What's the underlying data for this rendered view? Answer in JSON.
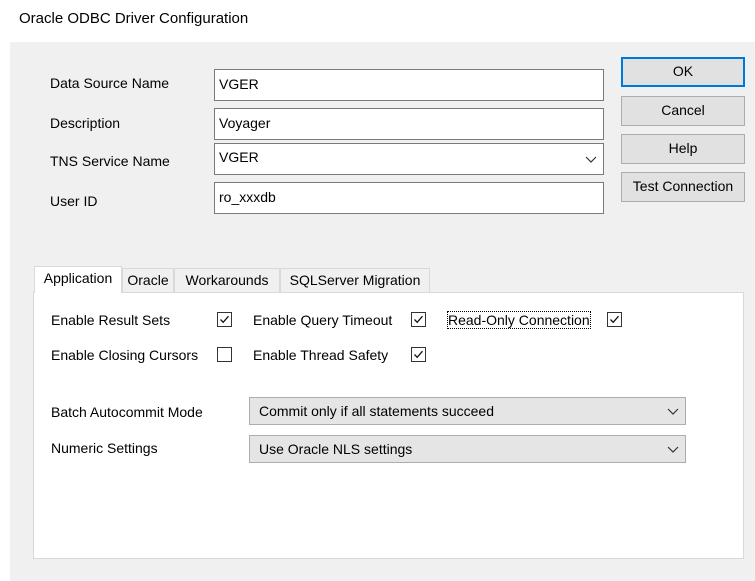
{
  "window": {
    "title": "Oracle ODBC Driver Configuration"
  },
  "form": {
    "data_source_name": {
      "label": "Data Source Name",
      "value": "VGER"
    },
    "description": {
      "label": "Description",
      "value": "Voyager"
    },
    "tns_service_name": {
      "label": "TNS Service Name",
      "value": "VGER"
    },
    "user_id": {
      "label": "User ID",
      "value": "ro_xxxdb"
    }
  },
  "buttons": {
    "ok": "OK",
    "cancel": "Cancel",
    "help": "Help",
    "test_connection": "Test Connection"
  },
  "tabs": [
    "Application",
    "Oracle",
    "Workarounds",
    "SQLServer Migration"
  ],
  "active_tab": "Application",
  "options": {
    "enable_result_sets": {
      "label": "Enable Result Sets",
      "checked": true
    },
    "enable_query_timeout": {
      "label": "Enable Query Timeout",
      "checked": true
    },
    "read_only_connection": {
      "label": "Read-Only Connection",
      "checked": true
    },
    "enable_closing_cursors": {
      "label": "Enable Closing Cursors",
      "checked": false
    },
    "enable_thread_safety": {
      "label": "Enable Thread Safety",
      "checked": true
    }
  },
  "batch_autocommit": {
    "label": "Batch Autocommit Mode",
    "value": "Commit only if all statements succeed"
  },
  "numeric_settings": {
    "label": "Numeric Settings",
    "value": "Use Oracle NLS settings"
  },
  "icons": {
    "checkmark": "checkmark-icon",
    "dropdown": "chevron-down-icon"
  }
}
